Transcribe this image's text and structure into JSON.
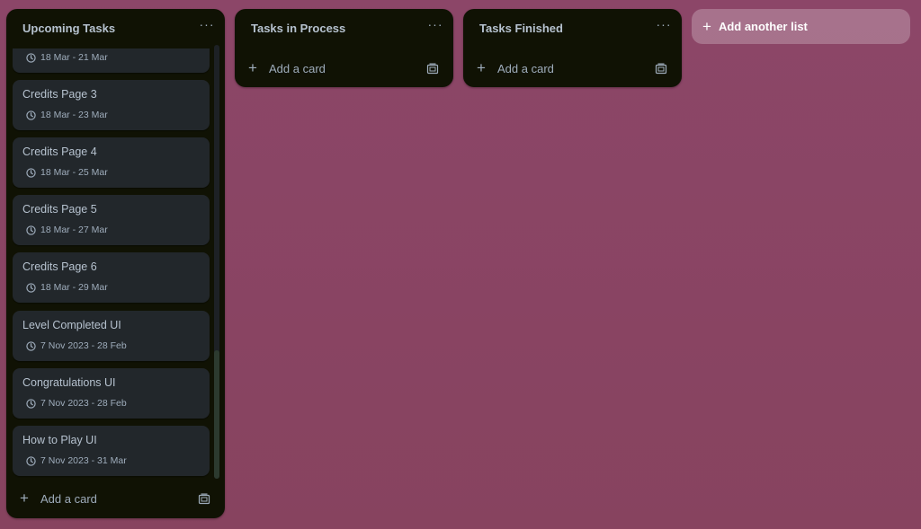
{
  "lists": [
    {
      "title": "Upcoming Tasks",
      "menu_icon": "ellipsis-icon",
      "add_card_label": "Add a card",
      "cards": [
        {
          "title": "",
          "date": "18 Mar - 21 Mar"
        },
        {
          "title": "Credits Page 3",
          "date": "18 Mar - 23 Mar"
        },
        {
          "title": "Credits Page 4",
          "date": "18 Mar - 25 Mar"
        },
        {
          "title": "Credits Page 5",
          "date": "18 Mar - 27 Mar"
        },
        {
          "title": "Credits Page 6",
          "date": "18 Mar - 29 Mar"
        },
        {
          "title": "Level Completed UI",
          "date": "7 Nov 2023 - 28 Feb"
        },
        {
          "title": "Congratulations UI",
          "date": "7 Nov 2023 - 28 Feb"
        },
        {
          "title": "How to Play UI",
          "date": "7 Nov 2023 - 31 Mar"
        }
      ]
    },
    {
      "title": "Tasks in Process",
      "menu_icon": "ellipsis-icon",
      "add_card_label": "Add a card",
      "cards": []
    },
    {
      "title": "Tasks Finished",
      "menu_icon": "ellipsis-icon",
      "add_card_label": "Add a card",
      "cards": []
    }
  ],
  "add_list_label": "Add another list",
  "icons": {
    "card_date": "clock-icon",
    "add": "plus-icon",
    "template": "card-template-icon",
    "menu": "ellipsis-icon"
  },
  "colors": {
    "board_background": "#8a4466",
    "list_background": "#101204",
    "card_background": "#22272b",
    "text_primary": "#b6c2cf",
    "text_secondary": "#9fadbc"
  }
}
